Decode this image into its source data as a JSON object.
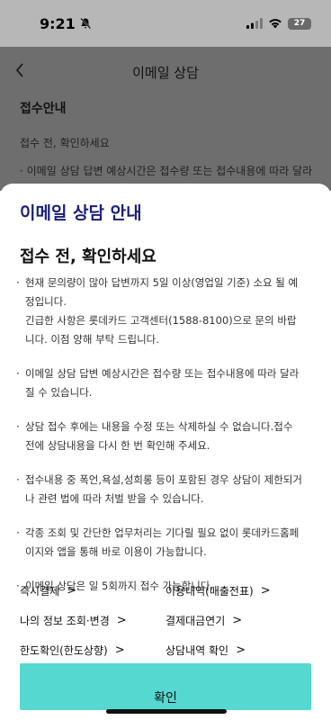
{
  "status_bar": {
    "time": "9:21",
    "battery": "27"
  },
  "background_page": {
    "title": "이메일 상담",
    "section_title": "접수안내",
    "subtitle": "접수 전, 확인하세요",
    "line": "· 이메일 상담 답변 예상시간은 접수량 또는 접수내용에 따라 달라"
  },
  "sheet": {
    "title": "이메일 상담 안내",
    "heading": "접수 전, 확인하세요",
    "notices": [
      [
        "현재 문의량이 많아 답변까지 5일 이상(영업일 기준) 소요 될 예",
        "정입니다.",
        "긴급한 사항은 롯데카드 고객센터(1588-8100)으로 문의 바랍",
        "니다. 이점 양해 부탁 드립니다."
      ],
      [
        "이메일 상담 답변 예상시간은 접수량 또는 접수내용에 따라 달라",
        "질 수 있습니다."
      ],
      [
        "상담 접수 후에는 내용을 수정 또는 삭제하실 수 없습니다.접수",
        "전에 상담내용을 다시 한 번 확인해 주세요."
      ],
      [
        "접수내용 중 폭언,욕설,성희롱 등이 포함된 경우 상담이 제한되거",
        "나 관련 법에 따라 처벌 받을 수 있습니다."
      ],
      [
        "각종 조회 및 간단한 업무처리는 기다릴 필요 없이 롯데카드홈페",
        "이지와 앱을 통해 바로 이용이 가능합니다."
      ],
      [
        "이메일 상담은 일 5회까지 접수 가능합니다."
      ]
    ],
    "links": [
      [
        "즉시결제",
        "이용내역(매출전표)"
      ],
      [
        "나의 정보 조회·변경",
        "결제대금연기"
      ],
      [
        "한도확인(한도상향)",
        "상담내역 확인"
      ]
    ],
    "confirm_label": "확인"
  }
}
